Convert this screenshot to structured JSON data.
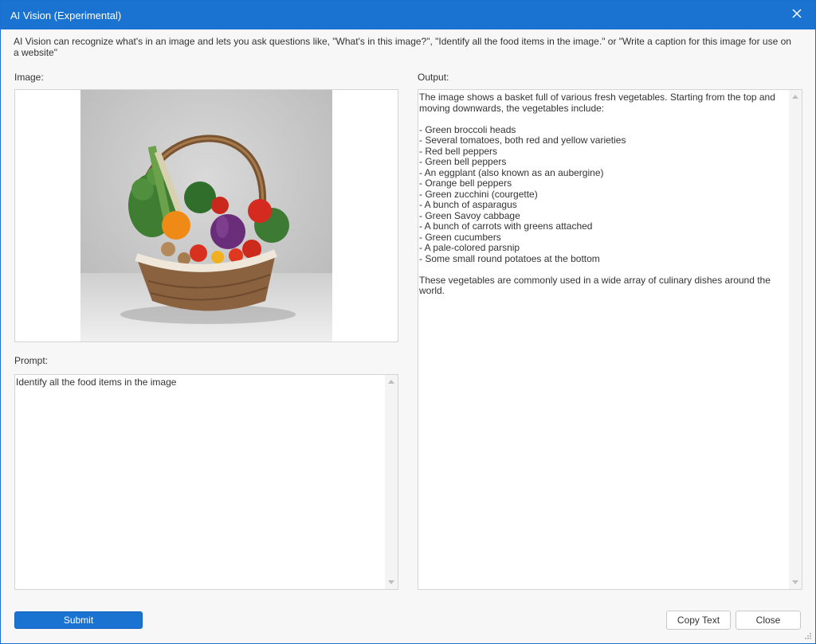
{
  "window": {
    "title": "AI Vision (Experimental)",
    "accent": "#1a73d1"
  },
  "description": "AI Vision can recognize what's in an image and lets you ask questions like, \"What's in this image?\", \"Identify all the food items in the image.\" or \"Write a caption for this image for use on a website\"",
  "image_section": {
    "label": "Image:",
    "image_alt": "Basket of fresh vegetables"
  },
  "prompt_section": {
    "label": "Prompt:",
    "value": "Identify all the food items in the image"
  },
  "output_section": {
    "label": "Output:",
    "text": "The image shows a basket full of various fresh vegetables. Starting from the top and\nmoving downwards, the vegetables include:\n\n- Green broccoli heads\n- Several tomatoes, both red and yellow varieties\n- Red bell peppers\n- Green bell peppers\n- An eggplant (also known as an aubergine)\n- Orange bell peppers\n- Green zucchini (courgette)\n- A bunch of asparagus\n- Green Savoy cabbage\n- A bunch of carrots with greens attached\n- Green cucumbers\n- A pale-colored parsnip\n- Some small round potatoes at the bottom\n\nThese vegetables are commonly used in a wide array of culinary dishes around the\nworld."
  },
  "buttons": {
    "submit": "Submit",
    "copy_text": "Copy Text",
    "close": "Close"
  }
}
